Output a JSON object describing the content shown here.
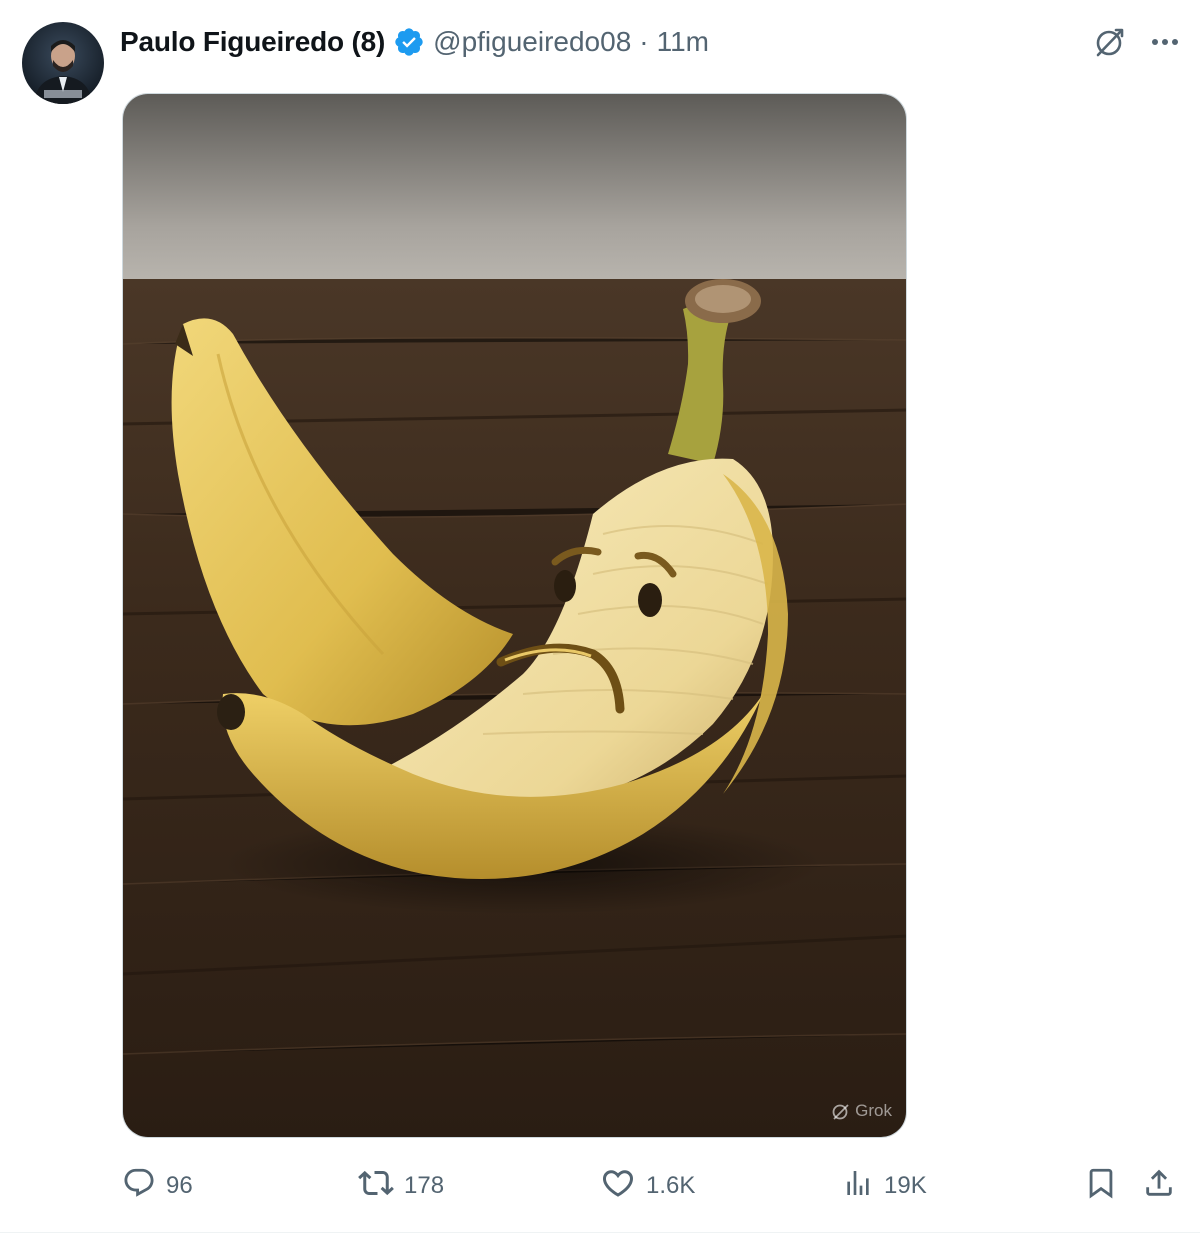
{
  "tweet": {
    "author": {
      "display_name": "Paulo Figueiredo (8)",
      "handle": "@pfigueiredo08",
      "verified": true,
      "avatar_icon": "profile-photo"
    },
    "separator": "·",
    "time": "11m",
    "header_icons": [
      "grok-icon",
      "more-icon"
    ],
    "media": {
      "watermark": "Grok"
    },
    "stats": {
      "replies": "96",
      "reposts": "178",
      "likes": "1.6K",
      "views": "19K"
    },
    "colors": {
      "verified_badge": "#1d9bf0",
      "secondary_text": "#536471",
      "primary_text": "#0f1419"
    }
  }
}
